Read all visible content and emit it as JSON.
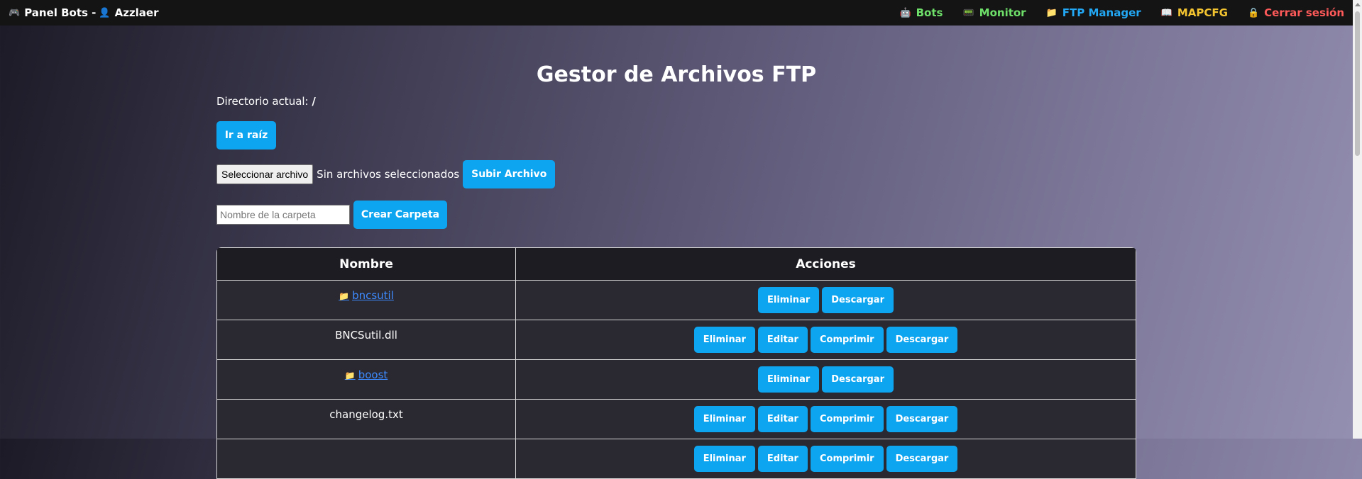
{
  "navbar": {
    "brand_icon": "🎮",
    "brand_title": "Panel Bots -",
    "user_icon": "👤",
    "user_name": "Azzlaer",
    "links": [
      {
        "icon": "🤖",
        "label": "Bots",
        "color": "#6ee06a"
      },
      {
        "icon": "📟",
        "label": "Monitor",
        "color": "#6ee06a"
      },
      {
        "icon": "📁",
        "label": "FTP Manager",
        "color": "#22a8f5"
      },
      {
        "icon": "📖",
        "label": "MAPCFG",
        "color": "#f4c430"
      },
      {
        "icon": "🔒",
        "label": "Cerrar sesión",
        "color": "#ff5a5a"
      }
    ]
  },
  "page": {
    "title": "Gestor de Archivos FTP",
    "current_dir_label": "Directorio actual:",
    "current_dir_value": "/",
    "root_button": "Ir a raíz",
    "file_choose_label": "Seleccionar archivo",
    "no_file_text": "Sin archivos seleccionados",
    "upload_button": "Subir Archivo",
    "folder_placeholder": "Nombre de la carpeta",
    "mkdir_button": "Crear Carpeta"
  },
  "table": {
    "headers": [
      "Nombre",
      "Acciones"
    ],
    "folder_icon": "📁",
    "rows": [
      {
        "name": "bncsutil",
        "type": "folder",
        "actions": [
          "Eliminar",
          "Descargar"
        ]
      },
      {
        "name": "BNCSutil.dll",
        "type": "file",
        "actions": [
          "Eliminar",
          "Editar",
          "Comprimir",
          "Descargar"
        ]
      },
      {
        "name": "boost",
        "type": "folder",
        "actions": [
          "Eliminar",
          "Descargar"
        ]
      },
      {
        "name": "changelog.txt",
        "type": "file",
        "actions": [
          "Eliminar",
          "Editar",
          "Comprimir",
          "Descargar"
        ]
      },
      {
        "name": "",
        "type": "file",
        "actions": [
          "Eliminar",
          "Editar",
          "Comprimir",
          "Descargar"
        ]
      }
    ]
  }
}
